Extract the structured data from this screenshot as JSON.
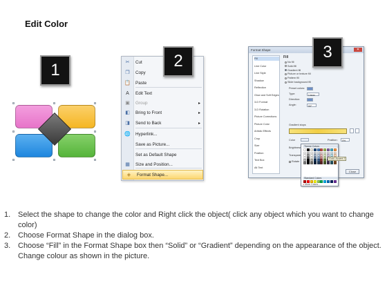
{
  "page": {
    "title": "Edit Color"
  },
  "steps": [
    "1",
    "2",
    "3"
  ],
  "shape_colors": {
    "pink": "#e774c9",
    "orange": "#f5b623",
    "blue": "#1e86de",
    "green": "#55b43a",
    "diamond": "#555555"
  },
  "context_menu": {
    "items": [
      {
        "icon": "scissors-icon",
        "glyph": "✂",
        "label": "Cut"
      },
      {
        "icon": "copy-icon",
        "glyph": "❐",
        "label": "Copy"
      },
      {
        "icon": "paste-icon",
        "glyph": "📋",
        "label": "Paste"
      },
      {
        "icon": "edit-text-icon",
        "glyph": "A",
        "label": "Edit Text"
      },
      {
        "icon": "group-icon",
        "glyph": "▣",
        "label": "Group"
      },
      {
        "icon": "bring-front-icon",
        "glyph": "◧",
        "label": "Bring to Front"
      },
      {
        "icon": "send-back-icon",
        "glyph": "◨",
        "label": "Send to Back"
      },
      {
        "icon": "hyperlink-icon",
        "glyph": "🌐",
        "label": "Hyperlink..."
      },
      {
        "icon": "none",
        "glyph": "",
        "label": "Save as Picture..."
      },
      {
        "icon": "none",
        "glyph": "",
        "label": "Set as Default Shape"
      },
      {
        "icon": "size-position-icon",
        "glyph": "▦",
        "label": "Size and Position..."
      },
      {
        "icon": "format-shape-icon",
        "glyph": "◈",
        "label": "Format Shape..."
      }
    ]
  },
  "format_dialog": {
    "title": "Format Shape",
    "close_label": "Close",
    "categories": [
      "Fill",
      "Line Color",
      "Line Style",
      "Shadow",
      "Reflection",
      "Glow and Soft Edges",
      "3-D Format",
      "3-D Rotation",
      "Picture Corrections",
      "Picture Color",
      "Artistic Effects",
      "Crop",
      "Size",
      "Position",
      "Text Box",
      "Alt Text"
    ],
    "section_title": "Fill",
    "fill_options": [
      "No fill",
      "Solid fill",
      "Gradient fill",
      "Picture or texture fill",
      "Pattern fill",
      "Slide background fill"
    ],
    "selected_fill": 2,
    "preset_colors_label": "Preset colors:",
    "type_label": "Type:",
    "type_value": "Linear",
    "direction_label": "Direction:",
    "angle_label": "Angle:",
    "angle_value": "90°",
    "gradient_stops_label": "Gradient stops",
    "color_label": "Color",
    "position_label": "Position:",
    "position_value": "0%",
    "brightness_label": "Brightness:",
    "transparency_label": "Transparency:",
    "rotate_label": "Rotate"
  },
  "color_picker": {
    "theme_label": "Theme Colors",
    "standard_label": "Standard Colors",
    "more_label": "More Colors...",
    "tooltip": "Gold, Accent 2",
    "theme_base": [
      "#ffffff",
      "#000000",
      "#eeece1",
      "#1f497d",
      "#4f81bd",
      "#c0504d",
      "#9bbb59",
      "#8064a2",
      "#4bacc6",
      "#f79646"
    ],
    "standard": [
      "#c00000",
      "#ff0000",
      "#ffc000",
      "#ffff00",
      "#92d050",
      "#00b050",
      "#00b0f0",
      "#0070c0",
      "#002060",
      "#7030a0"
    ]
  },
  "instructions": [
    {
      "num": "1.",
      "text": "Select the shape to change the color and Right click the object( click any object which you want to change color)"
    },
    {
      "num": "2.",
      "text": "Choose Format Shape in the dialog box."
    },
    {
      "num": "3.",
      "text": "Choose “Fill” in the Format Shape box then “Solid” or “Gradient” depending on the appearance of the object. Change colour as shown in the picture."
    }
  ]
}
